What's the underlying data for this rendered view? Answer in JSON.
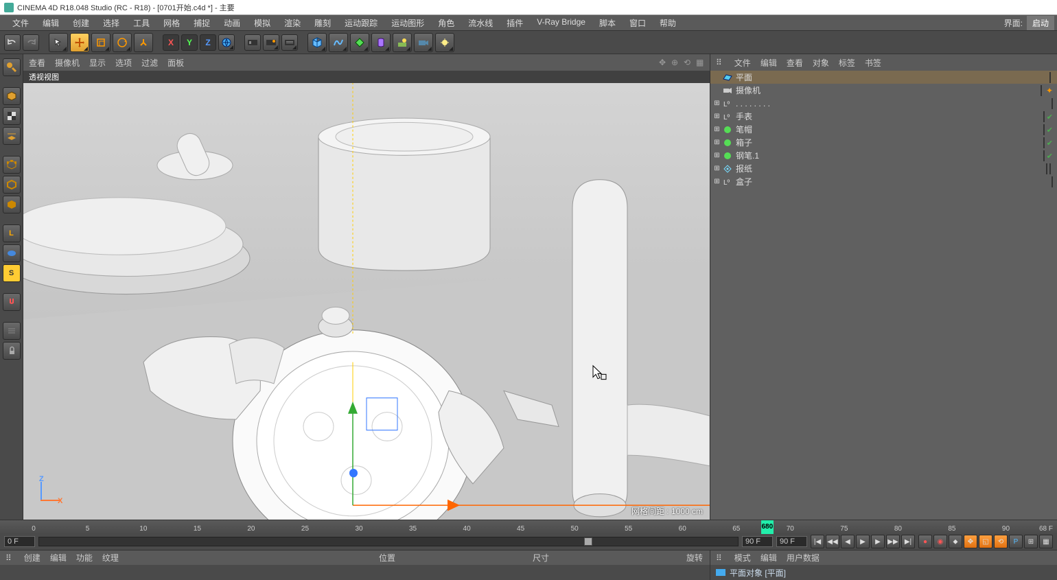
{
  "title": "CINEMA 4D R18.048 Studio (RC - R18) - [0701开始.c4d *] - 主要",
  "topmenu": [
    "文件",
    "编辑",
    "创建",
    "选择",
    "工具",
    "网格",
    "捕捉",
    "动画",
    "模拟",
    "渲染",
    "雕刻",
    "运动跟踪",
    "运动图形",
    "角色",
    "流水线",
    "插件",
    "V-Ray Bridge",
    "脚本",
    "窗口",
    "帮助"
  ],
  "interface_label": "界面:",
  "interface_value": "启动",
  "viewport_menu": [
    "查看",
    "摄像机",
    "显示",
    "选项",
    "过滤",
    "面板"
  ],
  "viewport_title": "透视视图",
  "grid_info": "网格间距 : 1000 cm",
  "object_menu": [
    "文件",
    "编辑",
    "查看",
    "对象",
    "标签",
    "书签"
  ],
  "objects": [
    {
      "name": "平面",
      "icon": "plane",
      "expander": "",
      "selected": true,
      "tags": [
        "box",
        "dot-orange"
      ]
    },
    {
      "name": "摄像机",
      "icon": "camera",
      "expander": "",
      "tags": [
        "box",
        "dot-black",
        "crosshair"
      ]
    },
    {
      "name": ". . . . . . . .",
      "icon": "null",
      "expander": "+",
      "tags": [
        "box"
      ]
    },
    {
      "name": "手表",
      "icon": "null",
      "expander": "+",
      "tags": [
        "box",
        "check"
      ]
    },
    {
      "name": "笔帽",
      "icon": "sphere",
      "expander": "+",
      "tags": [
        "box",
        "check"
      ]
    },
    {
      "name": "箱子",
      "icon": "sphere",
      "expander": "+",
      "tags": [
        "box",
        "check"
      ]
    },
    {
      "name": "钢笔.1",
      "icon": "sphere",
      "expander": "+",
      "tags": [
        "box",
        "check"
      ]
    },
    {
      "name": "报纸",
      "icon": "deformer",
      "expander": "+",
      "tags": [
        "box",
        "checker",
        "dot-orange"
      ]
    },
    {
      "name": "盒子",
      "icon": "null",
      "expander": "+",
      "tags": [
        "box"
      ]
    }
  ],
  "timeline": {
    "ticks": [
      "0",
      "5",
      "10",
      "15",
      "20",
      "25",
      "30",
      "35",
      "40",
      "45",
      "50",
      "55",
      "60",
      "65",
      "70",
      "75",
      "80",
      "85",
      "90"
    ],
    "current": "680",
    "current_label": "68 F",
    "start": "0 F",
    "end_left": "90 F",
    "end_right": "90 F"
  },
  "bottom_tabs": [
    "创建",
    "编辑",
    "功能",
    "纹理"
  ],
  "bottom_sections": [
    "位置",
    "尺寸",
    "旋转"
  ],
  "right_bottom_menu": [
    "模式",
    "编辑",
    "用户数据"
  ],
  "attr_obj": "平面对象 [平面]",
  "axis": {
    "x": "X",
    "y": "Y",
    "z": "Z"
  }
}
